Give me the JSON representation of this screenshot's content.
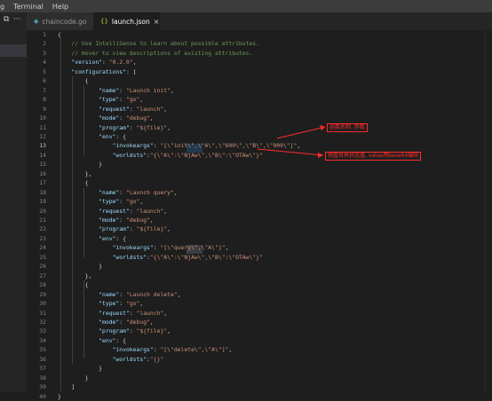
{
  "menubar": {
    "items": [
      "g",
      "Terminal",
      "Help"
    ]
  },
  "tabs": [
    {
      "label": "chaincode.go",
      "icon": "go-file-icon",
      "active": false
    },
    {
      "label": "launch.json",
      "icon": "json-file-icon",
      "active": true,
      "close": "×"
    }
  ],
  "editor": {
    "current_line": 13,
    "lines": [
      {
        "n": "1",
        "t": [
          [
            "p",
            "{"
          ]
        ]
      },
      {
        "n": "2",
        "t": [
          [
            "c",
            "    // Use IntelliSense to learn about possible attributes."
          ]
        ]
      },
      {
        "n": "3",
        "t": [
          [
            "c",
            "    // Hover to view descriptions of existing attributes."
          ]
        ]
      },
      {
        "n": "4",
        "t": [
          [
            "p",
            "    "
          ],
          [
            "k",
            "\"version\""
          ],
          [
            "p",
            ": "
          ],
          [
            "s",
            "\"0.2.0\""
          ],
          [
            "p",
            ","
          ]
        ]
      },
      {
        "n": "5",
        "t": [
          [
            "p",
            "    "
          ],
          [
            "k",
            "\"configurations\""
          ],
          [
            "p",
            ": ["
          ]
        ]
      },
      {
        "n": "6",
        "t": [
          [
            "p",
            "        {"
          ]
        ]
      },
      {
        "n": "7",
        "t": [
          [
            "p",
            "            "
          ],
          [
            "k",
            "\"name\""
          ],
          [
            "p",
            ": "
          ],
          [
            "s",
            "\"Launch init\""
          ],
          [
            "p",
            ","
          ]
        ]
      },
      {
        "n": "8",
        "t": [
          [
            "p",
            "            "
          ],
          [
            "k",
            "\"type\""
          ],
          [
            "p",
            ": "
          ],
          [
            "s",
            "\"go\""
          ],
          [
            "p",
            ","
          ]
        ]
      },
      {
        "n": "9",
        "t": [
          [
            "p",
            "            "
          ],
          [
            "k",
            "\"request\""
          ],
          [
            "p",
            ": "
          ],
          [
            "s",
            "\"launch\""
          ],
          [
            "p",
            ","
          ]
        ]
      },
      {
        "n": "10",
        "t": [
          [
            "p",
            "            "
          ],
          [
            "k",
            "\"mode\""
          ],
          [
            "p",
            ": "
          ],
          [
            "s",
            "\"debug\""
          ],
          [
            "p",
            ","
          ]
        ]
      },
      {
        "n": "11",
        "t": [
          [
            "p",
            "            "
          ],
          [
            "k",
            "\"program\""
          ],
          [
            "p",
            ": "
          ],
          [
            "s",
            "\"${file}\""
          ],
          [
            "p",
            ","
          ]
        ]
      },
      {
        "n": "12",
        "t": [
          [
            "p",
            "            "
          ],
          [
            "k",
            "\"env\""
          ],
          [
            "p",
            ": {"
          ]
        ]
      },
      {
        "n": "13",
        "t": [
          [
            "p",
            "                "
          ],
          [
            "k",
            "\"invokeargs\""
          ],
          [
            "p",
            ": "
          ],
          [
            "s",
            "\"[\\\"init\\\",\\\"A\\\",\\\"600\\\",\\\"B\\\",\\\"900\\\"]\""
          ],
          [
            "p",
            ","
          ]
        ]
      },
      {
        "n": "14",
        "t": [
          [
            "p",
            "                "
          ],
          [
            "k",
            "\"worldsts\""
          ],
          [
            "p",
            ":"
          ],
          [
            "s",
            "\"{\\\"A\\\":\\\"NjAw\\\",\\\"B\\\":\\\"OTAw\\\"}\""
          ]
        ]
      },
      {
        "n": "15",
        "t": [
          [
            "p",
            "            }"
          ]
        ]
      },
      {
        "n": "16",
        "t": [
          [
            "p",
            "        },"
          ]
        ]
      },
      {
        "n": "17",
        "t": [
          [
            "p",
            "        {"
          ]
        ]
      },
      {
        "n": "18",
        "t": [
          [
            "p",
            "            "
          ],
          [
            "k",
            "\"name\""
          ],
          [
            "p",
            ": "
          ],
          [
            "s",
            "\"Launch query\""
          ],
          [
            "p",
            ","
          ]
        ]
      },
      {
        "n": "19",
        "t": [
          [
            "p",
            "            "
          ],
          [
            "k",
            "\"type\""
          ],
          [
            "p",
            ": "
          ],
          [
            "s",
            "\"go\""
          ],
          [
            "p",
            ","
          ]
        ]
      },
      {
        "n": "20",
        "t": [
          [
            "p",
            "            "
          ],
          [
            "k",
            "\"request\""
          ],
          [
            "p",
            ": "
          ],
          [
            "s",
            "\"launch\""
          ],
          [
            "p",
            ","
          ]
        ]
      },
      {
        "n": "21",
        "t": [
          [
            "p",
            "            "
          ],
          [
            "k",
            "\"mode\""
          ],
          [
            "p",
            ": "
          ],
          [
            "s",
            "\"debug\""
          ],
          [
            "p",
            ","
          ]
        ]
      },
      {
        "n": "22",
        "t": [
          [
            "p",
            "            "
          ],
          [
            "k",
            "\"program\""
          ],
          [
            "p",
            ": "
          ],
          [
            "s",
            "\"${file}\""
          ],
          [
            "p",
            ","
          ]
        ]
      },
      {
        "n": "23",
        "t": [
          [
            "p",
            "            "
          ],
          [
            "k",
            "\"env\""
          ],
          [
            "p",
            ": {"
          ]
        ]
      },
      {
        "n": "24",
        "t": [
          [
            "p",
            "                "
          ],
          [
            "k",
            "\"invokeargs\""
          ],
          [
            "p",
            ": "
          ],
          [
            "s",
            "\"[\\\"query\\\",\\\"A\\\"]\""
          ],
          [
            "p",
            ","
          ]
        ]
      },
      {
        "n": "25",
        "t": [
          [
            "p",
            "                "
          ],
          [
            "k",
            "\"worldsts\""
          ],
          [
            "p",
            ":"
          ],
          [
            "s",
            "\"{\\\"A\\\":\\\"NjAw\\\",\\\"B\\\":\\\"OTAw\\\"}\""
          ]
        ]
      },
      {
        "n": "26",
        "t": [
          [
            "p",
            "            }"
          ]
        ]
      },
      {
        "n": "27",
        "t": [
          [
            "p",
            "        },"
          ]
        ]
      },
      {
        "n": "28",
        "t": [
          [
            "p",
            "        {"
          ]
        ]
      },
      {
        "n": "29",
        "t": [
          [
            "p",
            "            "
          ],
          [
            "k",
            "\"name\""
          ],
          [
            "p",
            ": "
          ],
          [
            "s",
            "\"Launch delete\""
          ],
          [
            "p",
            ","
          ]
        ]
      },
      {
        "n": "30",
        "t": [
          [
            "p",
            "            "
          ],
          [
            "k",
            "\"type\""
          ],
          [
            "p",
            ": "
          ],
          [
            "s",
            "\"go\""
          ],
          [
            "p",
            ","
          ]
        ]
      },
      {
        "n": "31",
        "t": [
          [
            "p",
            "            "
          ],
          [
            "k",
            "\"request\""
          ],
          [
            "p",
            ": "
          ],
          [
            "s",
            "\"launch\""
          ],
          [
            "p",
            ","
          ]
        ]
      },
      {
        "n": "32",
        "t": [
          [
            "p",
            "            "
          ],
          [
            "k",
            "\"mode\""
          ],
          [
            "p",
            ": "
          ],
          [
            "s",
            "\"debug\""
          ],
          [
            "p",
            ","
          ]
        ]
      },
      {
        "n": "33",
        "t": [
          [
            "p",
            "            "
          ],
          [
            "k",
            "\"program\""
          ],
          [
            "p",
            ": "
          ],
          [
            "s",
            "\"${file}\""
          ],
          [
            "p",
            ","
          ]
        ]
      },
      {
        "n": "34",
        "t": [
          [
            "p",
            "            "
          ],
          [
            "k",
            "\"env\""
          ],
          [
            "p",
            ": {"
          ]
        ]
      },
      {
        "n": "35",
        "t": [
          [
            "p",
            "                "
          ],
          [
            "k",
            "\"invokeargs\""
          ],
          [
            "p",
            ": "
          ],
          [
            "s",
            "\"[\\\"delete\\\",\\\"A\\\"]\""
          ],
          [
            "p",
            ","
          ]
        ]
      },
      {
        "n": "36",
        "t": [
          [
            "p",
            "                "
          ],
          [
            "k",
            "\"worldsts\""
          ],
          [
            "p",
            ":"
          ],
          [
            "s",
            "\"{}\""
          ]
        ]
      },
      {
        "n": "37",
        "t": [
          [
            "p",
            "            }"
          ]
        ]
      },
      {
        "n": "38",
        "t": [
          [
            "p",
            "        }"
          ]
        ]
      },
      {
        "n": "39",
        "t": [
          [
            "p",
            "    ]"
          ]
        ]
      },
      {
        "n": "40",
        "t": [
          [
            "p",
            "}"
          ]
        ]
      }
    ]
  },
  "annotations": [
    {
      "text": "函数名称, 参数"
    },
    {
      "text": "预置世界状态值, value用base64编码"
    }
  ],
  "colors": {
    "comment": "#6a9955",
    "key": "#9cdcfe",
    "string": "#ce9178",
    "annotation": "#ff2b2b"
  }
}
